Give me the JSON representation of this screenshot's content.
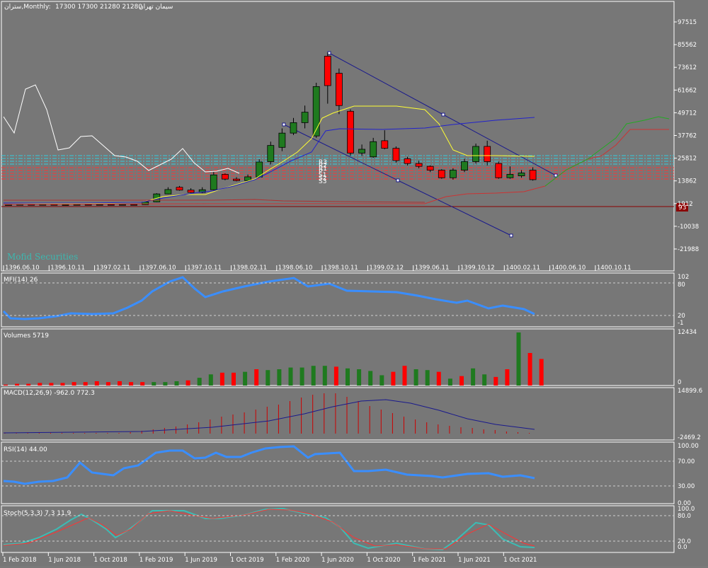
{
  "header": {
    "symbol": "سیمان تهران",
    "label": "ستران,Monthly:",
    "ohlc": "17300 17300 21280 21280"
  },
  "watermark": "Mofid Securities",
  "sr_labels": [
    "R3",
    "R2",
    "R1",
    "P",
    "S1",
    "S2",
    "S3"
  ],
  "colors": {
    "background": "#777777",
    "bull": "#1f7a1f",
    "bear": "#ff0000",
    "mfi": "#3a8eff",
    "stoch_main": "#3cbcb4",
    "stoch_signal": "#ff3333",
    "ichimoku_tenkan": "#ffff33",
    "ichimoku_kijun": "#2222cc",
    "ichimoku_chikou": "#ffffff",
    "pivot_cyan": "#33ccdd",
    "pivot_red": "#ff3333",
    "price_marker": "#8b0000"
  },
  "main_axis": {
    "ticks": [
      "97515",
      "85562",
      "73612",
      "61662",
      "49712",
      "37762",
      "25812",
      "13862",
      "1912",
      "-10038",
      "-21988"
    ],
    "current_price": "93",
    "x_labels": [
      "1396.06.10",
      "1396.10.11",
      "1397.02.11",
      "1397.06.10",
      "1397.10.11",
      "1398.02.11",
      "1398.06.10",
      "1398.10.11",
      "1399.02.12",
      "1399.06.11",
      "1399.10.12",
      "1400.02.11",
      "1400.06.10",
      "1400.10.11"
    ]
  },
  "mfi": {
    "title": "MFI(14) 26",
    "ticks": [
      "102",
      "80",
      "20",
      "-1"
    ]
  },
  "volumes": {
    "title": "Volumes 5719",
    "ticks": [
      "12434",
      "0"
    ]
  },
  "macd": {
    "title": "MACD(12,26,9) -962.0 772.3",
    "ticks": [
      "14899.6",
      "-2469.2"
    ]
  },
  "rsi": {
    "title": "RSI(14) 44.00",
    "ticks": [
      "100.00",
      "70.00",
      "30.00",
      "0.00"
    ]
  },
  "stoch": {
    "title": "Stoch(5,3,3) 7.3 11.9",
    "ticks": [
      "100.0",
      "80.0",
      "20.0",
      "0.0"
    ]
  },
  "bottom_axis": [
    "1 Feb 2018",
    "1 Jun 2018",
    "1 Oct 2018",
    "1 Feb 2019",
    "1 Jun 2019",
    "1 Oct 2019",
    "1 Feb 2020",
    "1 Jun 2020",
    "1 Oct 2020",
    "1 Feb 2021",
    "1 Jun 2021",
    "1 Oct 2021"
  ],
  "chart_data": {
    "type": "candlestick",
    "title": "",
    "candles": [
      {
        "o": 1200,
        "c": 1300,
        "h": 1400,
        "l": 1100
      },
      {
        "o": 1300,
        "c": 1400,
        "h": 1500,
        "l": 1200
      },
      {
        "o": 1400,
        "c": 1300,
        "h": 1500,
        "l": 1200
      },
      {
        "o": 1300,
        "c": 1400,
        "h": 1500,
        "l": 1200
      },
      {
        "o": 1400,
        "c": 1300,
        "h": 1500,
        "l": 1200
      },
      {
        "o": 1300,
        "c": 1300,
        "h": 1400,
        "l": 1200
      },
      {
        "o": 1300,
        "c": 1400,
        "h": 1500,
        "l": 1200
      },
      {
        "o": 1400,
        "c": 1300,
        "h": 1500,
        "l": 1200
      },
      {
        "o": 1300,
        "c": 1400,
        "h": 1500,
        "l": 1200
      },
      {
        "o": 1400,
        "c": 1300,
        "h": 1500,
        "l": 1200
      },
      {
        "o": 1300,
        "c": 1400,
        "h": 1500,
        "l": 1200
      },
      {
        "o": 1400,
        "c": 1300,
        "h": 1500,
        "l": 1200
      },
      {
        "o": 1300,
        "c": 2800,
        "h": 3000,
        "l": 1200
      },
      {
        "o": 2800,
        "c": 7000,
        "h": 7400,
        "l": 2600
      },
      {
        "o": 7000,
        "c": 9300,
        "h": 10500,
        "l": 6800
      },
      {
        "o": 10500,
        "c": 9000,
        "h": 11200,
        "l": 8700
      },
      {
        "o": 9000,
        "c": 7800,
        "h": 10000,
        "l": 7500
      },
      {
        "o": 7800,
        "c": 9200,
        "h": 10500,
        "l": 7400
      },
      {
        "o": 9200,
        "c": 17000,
        "h": 18500,
        "l": 9000
      },
      {
        "o": 17300,
        "c": 14800,
        "h": 17800,
        "l": 14200
      },
      {
        "o": 14800,
        "c": 14000,
        "h": 15800,
        "l": 13600
      },
      {
        "o": 14000,
        "c": 16000,
        "h": 17200,
        "l": 13800
      },
      {
        "o": 15900,
        "c": 23800,
        "h": 25200,
        "l": 15700
      },
      {
        "o": 24000,
        "c": 32500,
        "h": 34500,
        "l": 22500
      },
      {
        "o": 31500,
        "c": 39000,
        "h": 41500,
        "l": 29500
      },
      {
        "o": 39000,
        "c": 44500,
        "h": 47000,
        "l": 38000
      },
      {
        "o": 44500,
        "c": 50000,
        "h": 53500,
        "l": 41500
      },
      {
        "o": 37500,
        "c": 63500,
        "h": 65500,
        "l": 36500
      },
      {
        "o": 79500,
        "c": 64000,
        "h": 81500,
        "l": 54500
      },
      {
        "o": 70500,
        "c": 53500,
        "h": 73000,
        "l": 49000
      },
      {
        "o": 50500,
        "c": 28500,
        "h": 51500,
        "l": 27000
      },
      {
        "o": 28500,
        "c": 30500,
        "h": 33000,
        "l": 27000
      },
      {
        "o": 26500,
        "c": 34500,
        "h": 36500,
        "l": 26000
      },
      {
        "o": 35000,
        "c": 31000,
        "h": 40500,
        "l": 30500
      },
      {
        "o": 31000,
        "c": 24500,
        "h": 32000,
        "l": 23500
      },
      {
        "o": 25500,
        "c": 23000,
        "h": 26500,
        "l": 22000
      },
      {
        "o": 23000,
        "c": 21500,
        "h": 24500,
        "l": 20500
      },
      {
        "o": 21500,
        "c": 19500,
        "h": 22000,
        "l": 18500
      },
      {
        "o": 19500,
        "c": 15500,
        "h": 20000,
        "l": 15000
      },
      {
        "o": 15500,
        "c": 19500,
        "h": 20500,
        "l": 14500
      },
      {
        "o": 19500,
        "c": 24000,
        "h": 25500,
        "l": 18500
      },
      {
        "o": 24000,
        "c": 32000,
        "h": 33500,
        "l": 23000
      },
      {
        "o": 32000,
        "c": 24000,
        "h": 35000,
        "l": 22000
      },
      {
        "o": 23000,
        "c": 15500,
        "h": 24000,
        "l": 15000
      },
      {
        "o": 15500,
        "c": 17300,
        "h": 21500,
        "l": 15000
      },
      {
        "o": 16500,
        "c": 18000,
        "h": 19500,
        "l": 15500
      },
      {
        "o": 19500,
        "c": 14500,
        "h": 21000,
        "l": 14000
      }
    ],
    "ylim": [
      -21988,
      97515
    ]
  }
}
